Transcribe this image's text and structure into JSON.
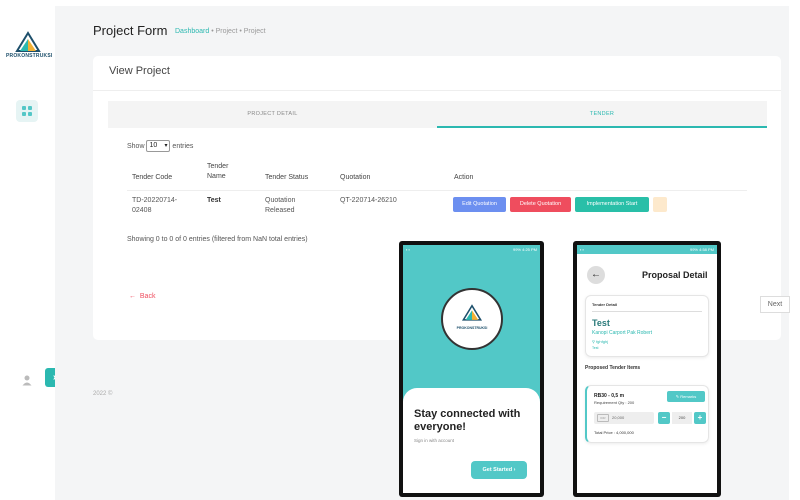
{
  "sidebar": {
    "logo_text": "PROKONSTRUKSI"
  },
  "header": {
    "title": "Project Form",
    "breadcrumbs": [
      "Dashboard",
      "Project",
      "Project"
    ]
  },
  "card": {
    "title": "View Project",
    "tabs": [
      "PROJECT DETAIL",
      "TENDER"
    ]
  },
  "table": {
    "show_label": "Show",
    "show_value": "10",
    "entries_label": "entries",
    "headers": [
      "Tender Code",
      "Tender Name",
      "Tender Status",
      "Quotation",
      "Action"
    ],
    "rows": [
      {
        "code": "TD-20220714-02408",
        "name": "Test",
        "status": "Quotation Released",
        "quotation": "QT-220714-26210",
        "actions": [
          "Edit Quotation",
          "Delete Quotation",
          "Implementation Start"
        ]
      }
    ],
    "info": "Showing 0 to 0 of 0 entries (filtered from NaN total entries)",
    "next_label": "Next"
  },
  "back_label": "Back",
  "footer": "2022 ©",
  "phone1": {
    "headline": "Stay connected with everyone!",
    "subtext": "Sign in with account",
    "cta": "Get Started",
    "status_right": "99%  4:25 PM",
    "logo_text": "PROKONSTRUKSI"
  },
  "phone2": {
    "title": "Proposal Detail",
    "status_right": "99%  4:58 PM",
    "tender_detail_label": "Tender Detail",
    "tender_name": "Test",
    "tender_sub": "Kanopi Carport Pak Robert",
    "tender_loc": "fghfghj",
    "tender_loc2": "Test",
    "items_label": "Proposed Tender Items",
    "item": {
      "name": "RB30 - 0,5 m",
      "requirement": "Requirement Qty : 200",
      "remarks": "Remarks",
      "currency": "IDR",
      "price": "20,000",
      "qty": "200",
      "total": "Total Price : 4,000,000"
    }
  },
  "colors": {
    "accent": "#2bb8b0",
    "teal_screen": "#52c8c7",
    "edit": "#6c8ff0",
    "delete": "#ef4d5e",
    "implement": "#29bfa8"
  }
}
